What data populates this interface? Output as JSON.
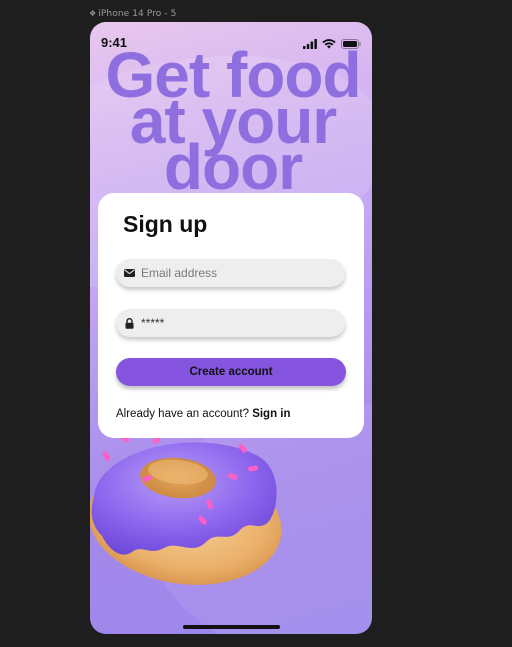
{
  "frame": {
    "label": "iPhone 14 Pro - 5",
    "icon": "frame-icon"
  },
  "status_bar": {
    "time": "9:41",
    "icons": [
      "signal-icon",
      "wifi-icon",
      "battery-icon"
    ]
  },
  "hero": {
    "line1": "Get food",
    "line2": "at your",
    "line3": "door"
  },
  "signup": {
    "title": "Sign up",
    "email_placeholder": "Email address",
    "email_value": "",
    "password_value": "*****",
    "submit_label": "Create account",
    "prompt_text": "Already have an account? ",
    "signin_label": "Sign in"
  },
  "colors": {
    "accent": "#8555e0",
    "headline": "#8f6fe0",
    "background_dark": "#1e1e1e",
    "card": "#ffffff"
  }
}
